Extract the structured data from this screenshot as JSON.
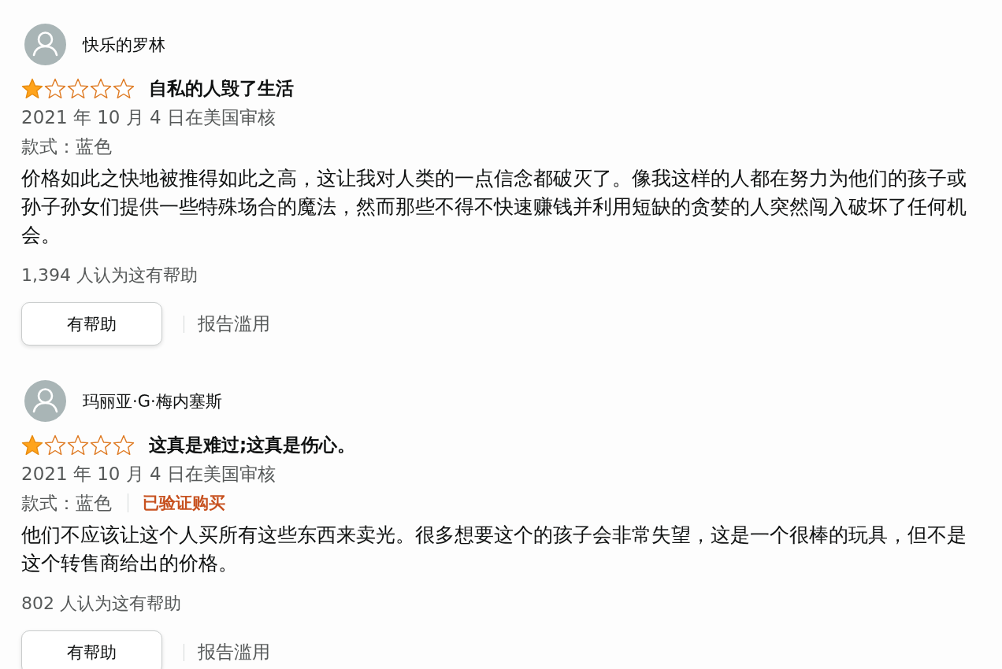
{
  "reviews": [
    {
      "reviewer": {
        "name": "快乐的罗林"
      },
      "stars": 1,
      "title": "自私的人毁了生活",
      "date": "2021 年 10 月 4 日在美国审核",
      "style": "款式：蓝色",
      "body": "价格如此之快地被推得如此之高，这让我对人类的一点信念都破灭了。像我这样的人都在努力为他们的孩子或孙子孙女们提供一些特殊场合的魔法，然而那些不得不快速赚钱并利用短缺的贪婪的人突然闯入破坏了任何机会。",
      "helpful_count": "1,394 人认为这有帮助",
      "helpful_button": "有帮助",
      "report_link": "报告滥用"
    },
    {
      "reviewer": {
        "name": "玛丽亚·G·梅内塞斯"
      },
      "stars": 1,
      "title": "这真是难过;这真是伤心。",
      "date": "2021 年 10 月 4 日在美国审核",
      "style": "款式：蓝色",
      "badge": "已验证购买",
      "body": "他们不应该让这个人买所有这些东西来卖光。很多想要这个的孩子会非常失望，这是一个很棒的玩具，但不是这个转售商给出的价格。",
      "helpful_count": "802 人认为这有帮助",
      "helpful_button": "有帮助",
      "report_link": "报告滥用"
    }
  ]
}
